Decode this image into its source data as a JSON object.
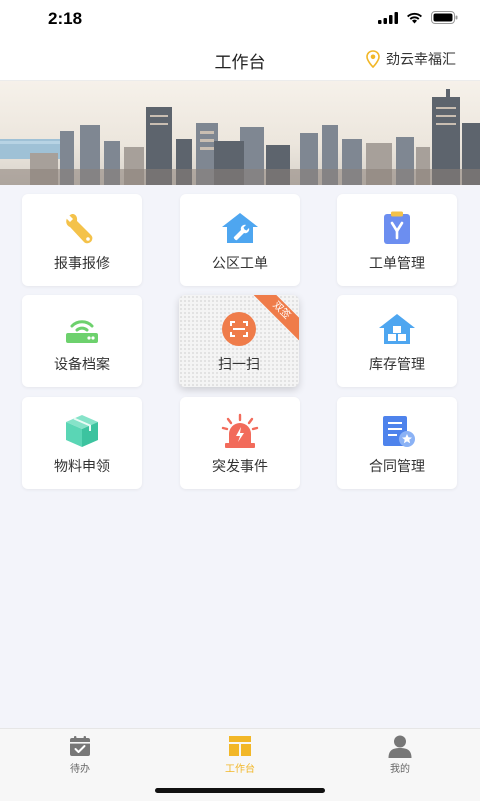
{
  "status_bar": {
    "time": "2:18"
  },
  "header": {
    "title": "工作台",
    "location": "劲云幸福汇"
  },
  "grid": {
    "items": [
      {
        "label": "报事报修",
        "icon": "wrench-icon"
      },
      {
        "label": "公区工单",
        "icon": "house-wrench-icon"
      },
      {
        "label": "工单管理",
        "icon": "clipboard-icon"
      },
      {
        "label": "设备档案",
        "icon": "router-icon"
      },
      {
        "label": "扫一扫",
        "icon": "scan-icon",
        "badge": "双签"
      },
      {
        "label": "库存管理",
        "icon": "warehouse-icon"
      },
      {
        "label": "物料申领",
        "icon": "box-icon"
      },
      {
        "label": "突发事件",
        "icon": "alarm-icon"
      },
      {
        "label": "合同管理",
        "icon": "contract-icon"
      }
    ]
  },
  "tabs": [
    {
      "label": "待办",
      "icon": "calendar-check-icon",
      "active": false
    },
    {
      "label": "工作台",
      "icon": "dashboard-icon",
      "active": true
    },
    {
      "label": "我的",
      "icon": "user-icon",
      "active": false
    }
  ],
  "colors": {
    "accent": "#f2b728",
    "wrench": "#f4c24a",
    "blue": "#4ea6f0",
    "purple_blue": "#6c8ef0",
    "green": "#6dd16d",
    "orange": "#ef7c4a",
    "teal": "#5ad6b5",
    "red": "#f26b5b"
  }
}
